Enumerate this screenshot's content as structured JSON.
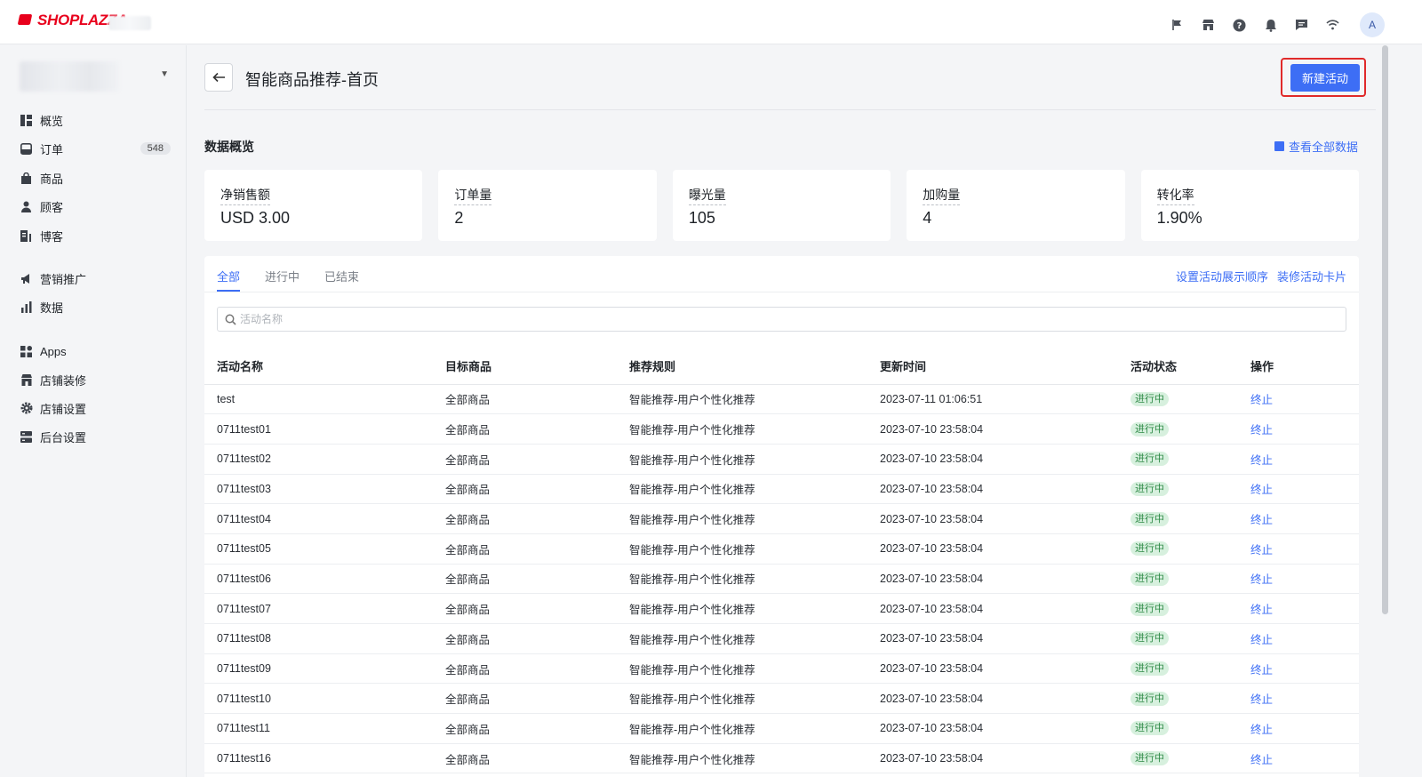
{
  "brand": {
    "name": "SHOPLAZZA",
    "color": "#e8001c"
  },
  "topbar": {
    "icons": [
      "flag-icon",
      "store-icon",
      "help-icon",
      "bell-icon",
      "message-icon",
      "wifi-icon"
    ],
    "avatar_letter": "A"
  },
  "sidebar": {
    "items": [
      {
        "label": "概览",
        "icon": "overview-icon"
      },
      {
        "label": "订单",
        "icon": "order-icon",
        "badge": "548"
      },
      {
        "label": "商品",
        "icon": "product-icon"
      },
      {
        "label": "顾客",
        "icon": "customer-icon"
      },
      {
        "label": "博客",
        "icon": "blog-icon"
      },
      {
        "label": "营销推广",
        "icon": "marketing-icon"
      },
      {
        "label": "数据",
        "icon": "analytics-icon"
      },
      {
        "label": "Apps",
        "icon": "apps-icon"
      },
      {
        "label": "店铺装修",
        "icon": "storefront-icon"
      },
      {
        "label": "店铺设置",
        "icon": "settings-icon"
      },
      {
        "label": "后台设置",
        "icon": "admin-settings-icon"
      }
    ]
  },
  "header": {
    "title": "智能商品推荐-首页",
    "create_button": "新建活动"
  },
  "overview": {
    "title": "数据概览",
    "view_all": "查看全部数据",
    "stats": [
      {
        "label": "净销售额",
        "value": "USD 3.00"
      },
      {
        "label": "订单量",
        "value": "2"
      },
      {
        "label": "曝光量",
        "value": "105"
      },
      {
        "label": "加购量",
        "value": "4"
      },
      {
        "label": "转化率",
        "value": "1.90%"
      }
    ]
  },
  "tabs": [
    "全部",
    "进行中",
    "已结束"
  ],
  "tab_links": [
    "设置活动展示顺序",
    "装修活动卡片"
  ],
  "search": {
    "placeholder": "活动名称"
  },
  "table": {
    "headers": [
      "活动名称",
      "目标商品",
      "推荐规则",
      "更新时间",
      "活动状态",
      "操作"
    ],
    "rows": [
      [
        "test",
        "全部商品",
        "智能推荐-用户个性化推荐",
        "2023-07-11 01:06:51",
        "进行中",
        "终止"
      ],
      [
        "0711test01",
        "全部商品",
        "智能推荐-用户个性化推荐",
        "2023-07-10 23:58:04",
        "进行中",
        "终止"
      ],
      [
        "0711test02",
        "全部商品",
        "智能推荐-用户个性化推荐",
        "2023-07-10 23:58:04",
        "进行中",
        "终止"
      ],
      [
        "0711test03",
        "全部商品",
        "智能推荐-用户个性化推荐",
        "2023-07-10 23:58:04",
        "进行中",
        "终止"
      ],
      [
        "0711test04",
        "全部商品",
        "智能推荐-用户个性化推荐",
        "2023-07-10 23:58:04",
        "进行中",
        "终止"
      ],
      [
        "0711test05",
        "全部商品",
        "智能推荐-用户个性化推荐",
        "2023-07-10 23:58:04",
        "进行中",
        "终止"
      ],
      [
        "0711test06",
        "全部商品",
        "智能推荐-用户个性化推荐",
        "2023-07-10 23:58:04",
        "进行中",
        "终止"
      ],
      [
        "0711test07",
        "全部商品",
        "智能推荐-用户个性化推荐",
        "2023-07-10 23:58:04",
        "进行中",
        "终止"
      ],
      [
        "0711test08",
        "全部商品",
        "智能推荐-用户个性化推荐",
        "2023-07-10 23:58:04",
        "进行中",
        "终止"
      ],
      [
        "0711test09",
        "全部商品",
        "智能推荐-用户个性化推荐",
        "2023-07-10 23:58:04",
        "进行中",
        "终止"
      ],
      [
        "0711test10",
        "全部商品",
        "智能推荐-用户个性化推荐",
        "2023-07-10 23:58:04",
        "进行中",
        "终止"
      ],
      [
        "0711test11",
        "全部商品",
        "智能推荐-用户个性化推荐",
        "2023-07-10 23:58:04",
        "进行中",
        "终止"
      ],
      [
        "0711test16",
        "全部商品",
        "智能推荐-用户个性化推荐",
        "2023-07-10 23:58:04",
        "进行中",
        "终止"
      ]
    ]
  },
  "colors": {
    "accent": "#3d6ef5",
    "status_bg": "#d7f0de",
    "status_text": "#2f8a47",
    "highlight": "#e02a2a"
  }
}
